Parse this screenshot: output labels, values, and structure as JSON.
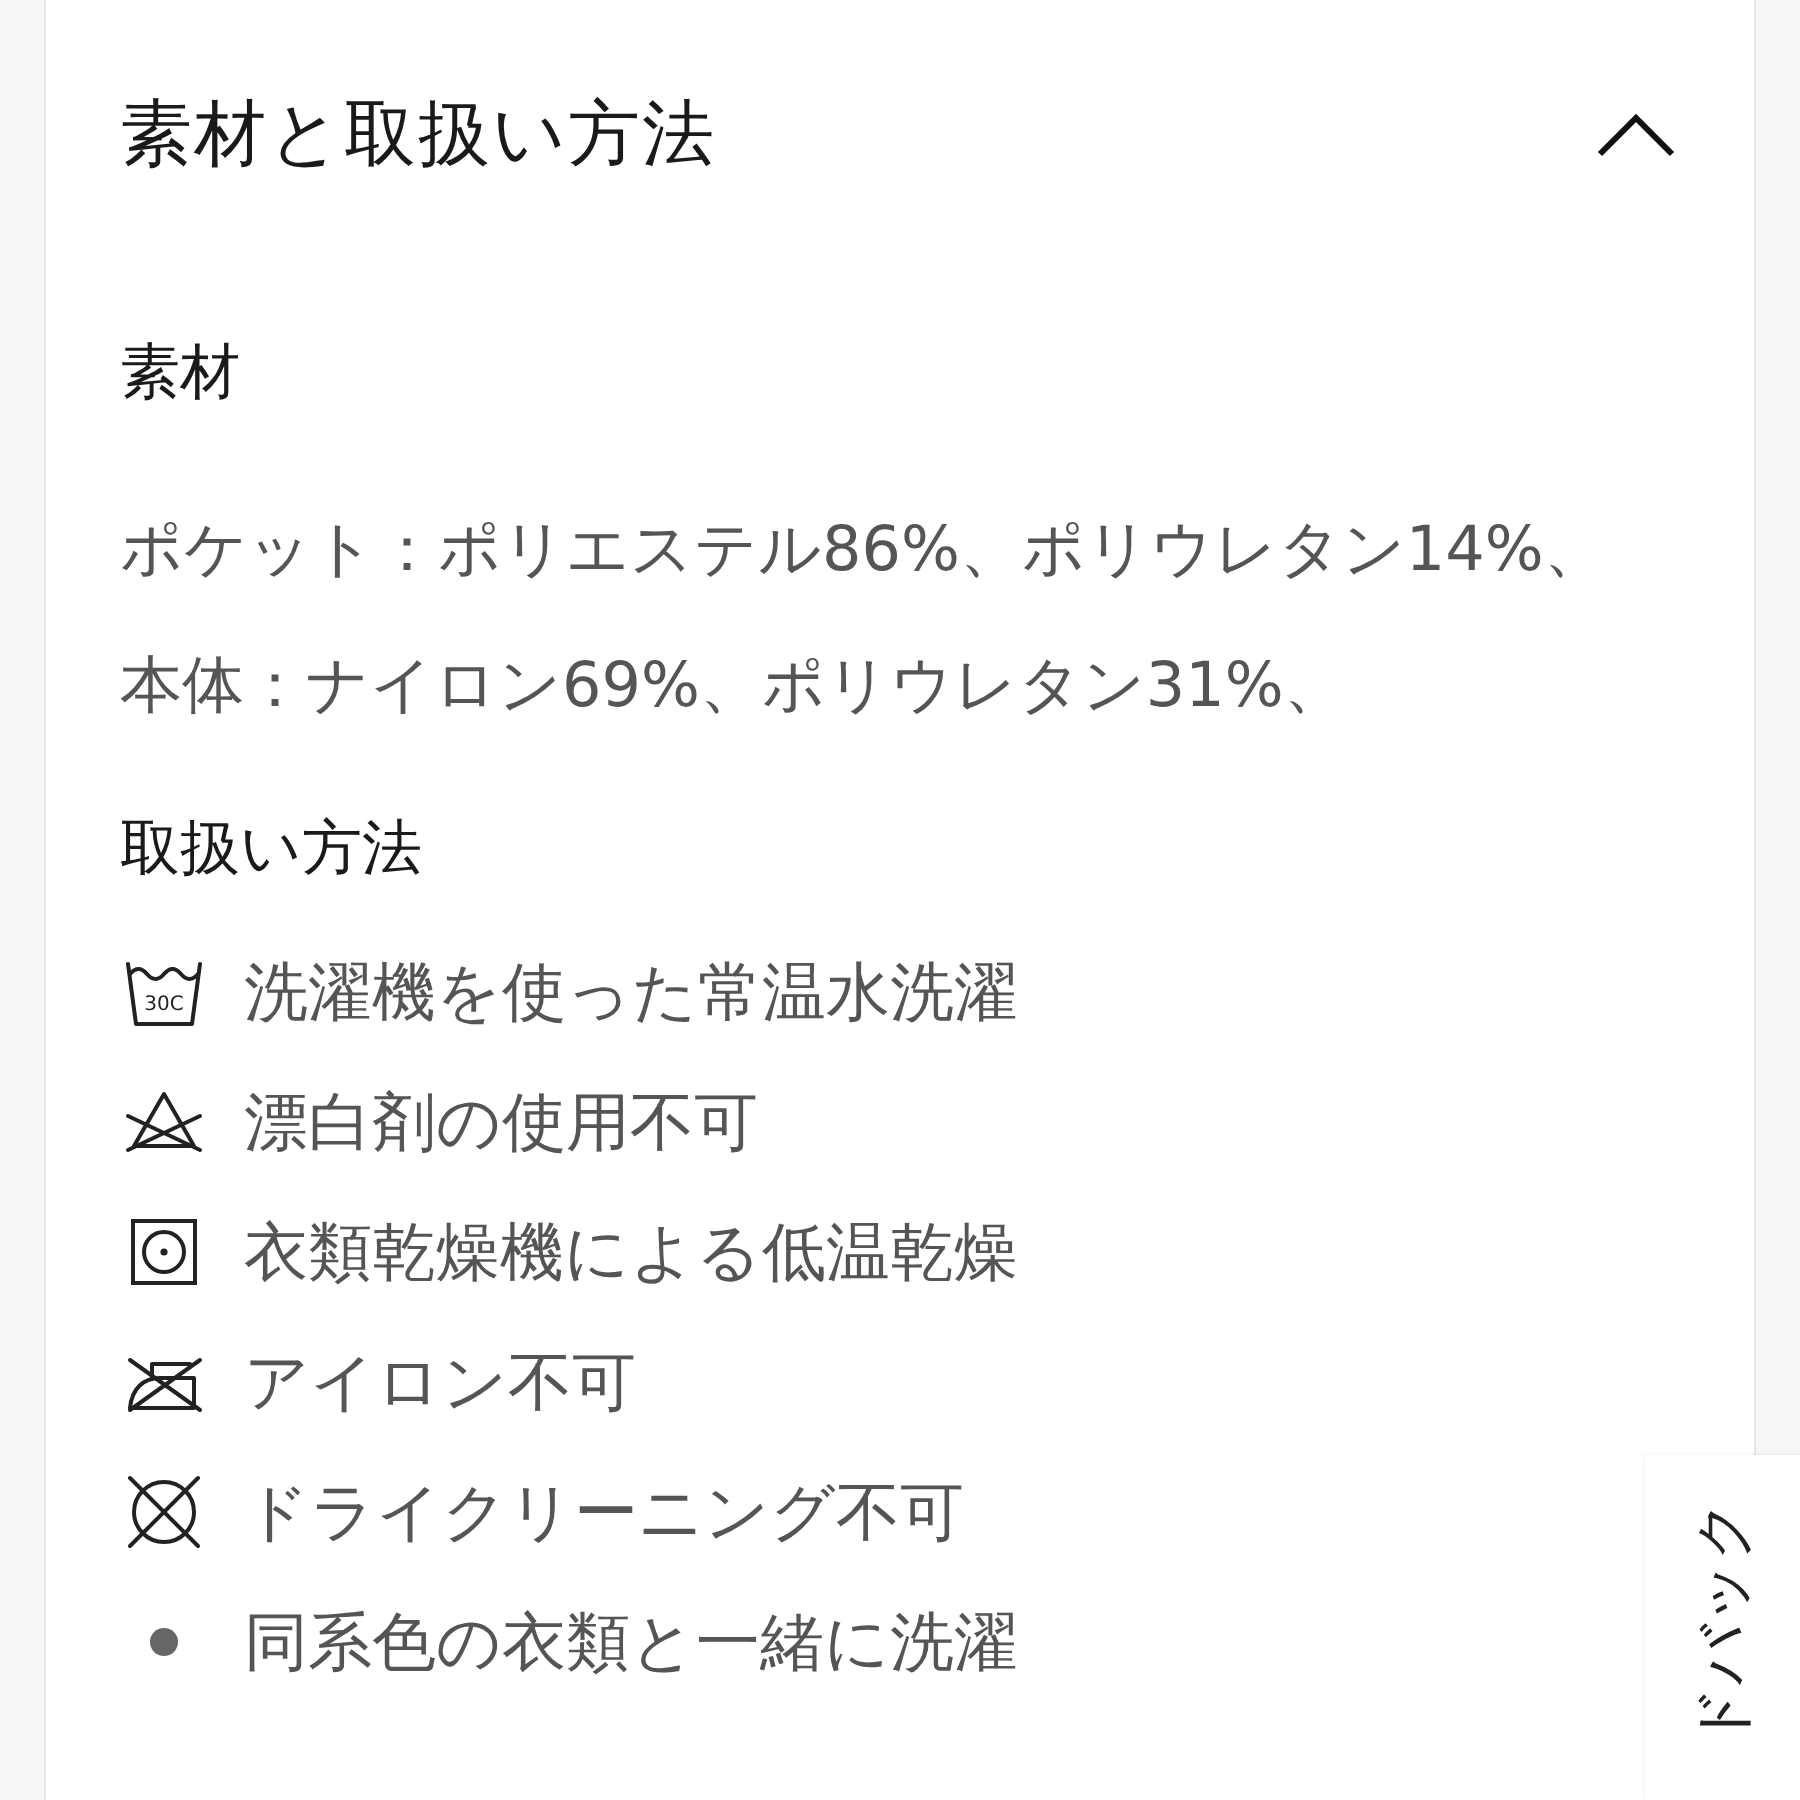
{
  "section": {
    "title": "素材と取扱い方法",
    "expanded": true,
    "materials": {
      "heading": "素材",
      "lines": [
        "ポケット：ポリエステル86%、ポリウレタン14%、",
        "本体：ナイロン69%、ポリウレタン31%、"
      ]
    },
    "care": {
      "heading": "取扱い方法",
      "items": [
        {
          "kind": "wash",
          "temperature": "30C",
          "text": "洗濯機を使った常温水洗濯"
        },
        {
          "kind": "no-bleach",
          "text": "漂白剤の使用不可"
        },
        {
          "kind": "tumble-dry",
          "text": "衣類乾燥機による低温乾燥"
        },
        {
          "kind": "no-iron",
          "text": "アイロン不可"
        },
        {
          "kind": "no-dry-clean",
          "text": "ドライクリーニング不可"
        },
        {
          "kind": "bullet",
          "text": "同系色の衣類と一緒に洗濯"
        }
      ]
    }
  },
  "feedback_tab": {
    "label": "ドバック"
  }
}
